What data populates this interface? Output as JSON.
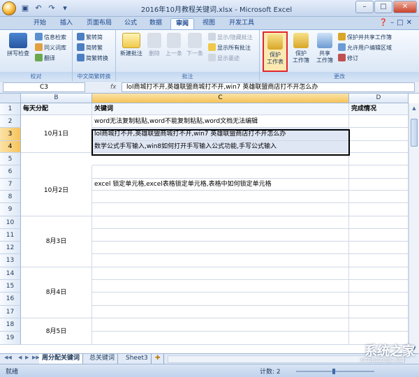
{
  "title": "2016年10月教程关键词.xlsx - Microsoft Excel",
  "tabs": [
    "开始",
    "插入",
    "页面布局",
    "公式",
    "数据",
    "审阅",
    "视图",
    "开发工具"
  ],
  "active_tab": "审阅",
  "ribbon": {
    "proofing": {
      "label": "校对",
      "spelling": "拼写检查",
      "research": "信息检索",
      "thesaurus": "同义词库",
      "translate": "翻译"
    },
    "chinese": {
      "label": "中文简繁转换",
      "to_trad": "繁转简",
      "to_simp": "简转繁",
      "convert": "简繁转换"
    },
    "comments": {
      "label": "批注",
      "new": "新建批注",
      "delete": "删除",
      "prev": "上一条",
      "next": "下一条",
      "show_hide": "显示/隐藏批注",
      "show_all": "显示所有批注",
      "show_ink": "显示墨迹"
    },
    "changes": {
      "label": "更改",
      "protect_sheet": "保护\n工作表",
      "protect_workbook": "保护\n工作簿",
      "share_workbook": "共享\n工作簿",
      "protect_share": "保护并共享工作簿",
      "allow_edit": "允许用户编辑区域",
      "track": "修订"
    }
  },
  "namebox": "C3",
  "formula": "lol商城打不开,英雄联盟商城打不开,win7 英雄联盟商店打不开怎么办",
  "columns": [
    "B",
    "C",
    "D"
  ],
  "rows": [
    "1",
    "2",
    "3",
    "4",
    "5",
    "6",
    "7",
    "8",
    "9",
    "10",
    "11",
    "12",
    "13",
    "14",
    "15",
    "16",
    "17",
    "18",
    "19"
  ],
  "headers": {
    "b": "每天分配",
    "c": "关键词",
    "d": "完成情况"
  },
  "dates": [
    "10月1日",
    "10月2日",
    "8月3日",
    "8月4日",
    "8月5日"
  ],
  "cells": {
    "c2": "word无法复制粘贴,word不能复制粘贴,word文档无法编辑",
    "c3": "lol商城打不开,英雄联盟商城打不开,win7 英雄联盟商店打不开怎么办",
    "c4": "数学公式手写输入,win8如何打开手写输入公式功能,手写公式输入",
    "c7": "excel 锁定单元格,excel表格锁定单元格,表格中如何锁定单元格"
  },
  "sheets": [
    "周分配关键词",
    "总关键词",
    "Sheet3"
  ],
  "status": {
    "ready": "就绪",
    "count": "计数: 2"
  },
  "watermark": {
    "main": "系统之家",
    "sub": "XITONGZHIJIA.NET"
  }
}
